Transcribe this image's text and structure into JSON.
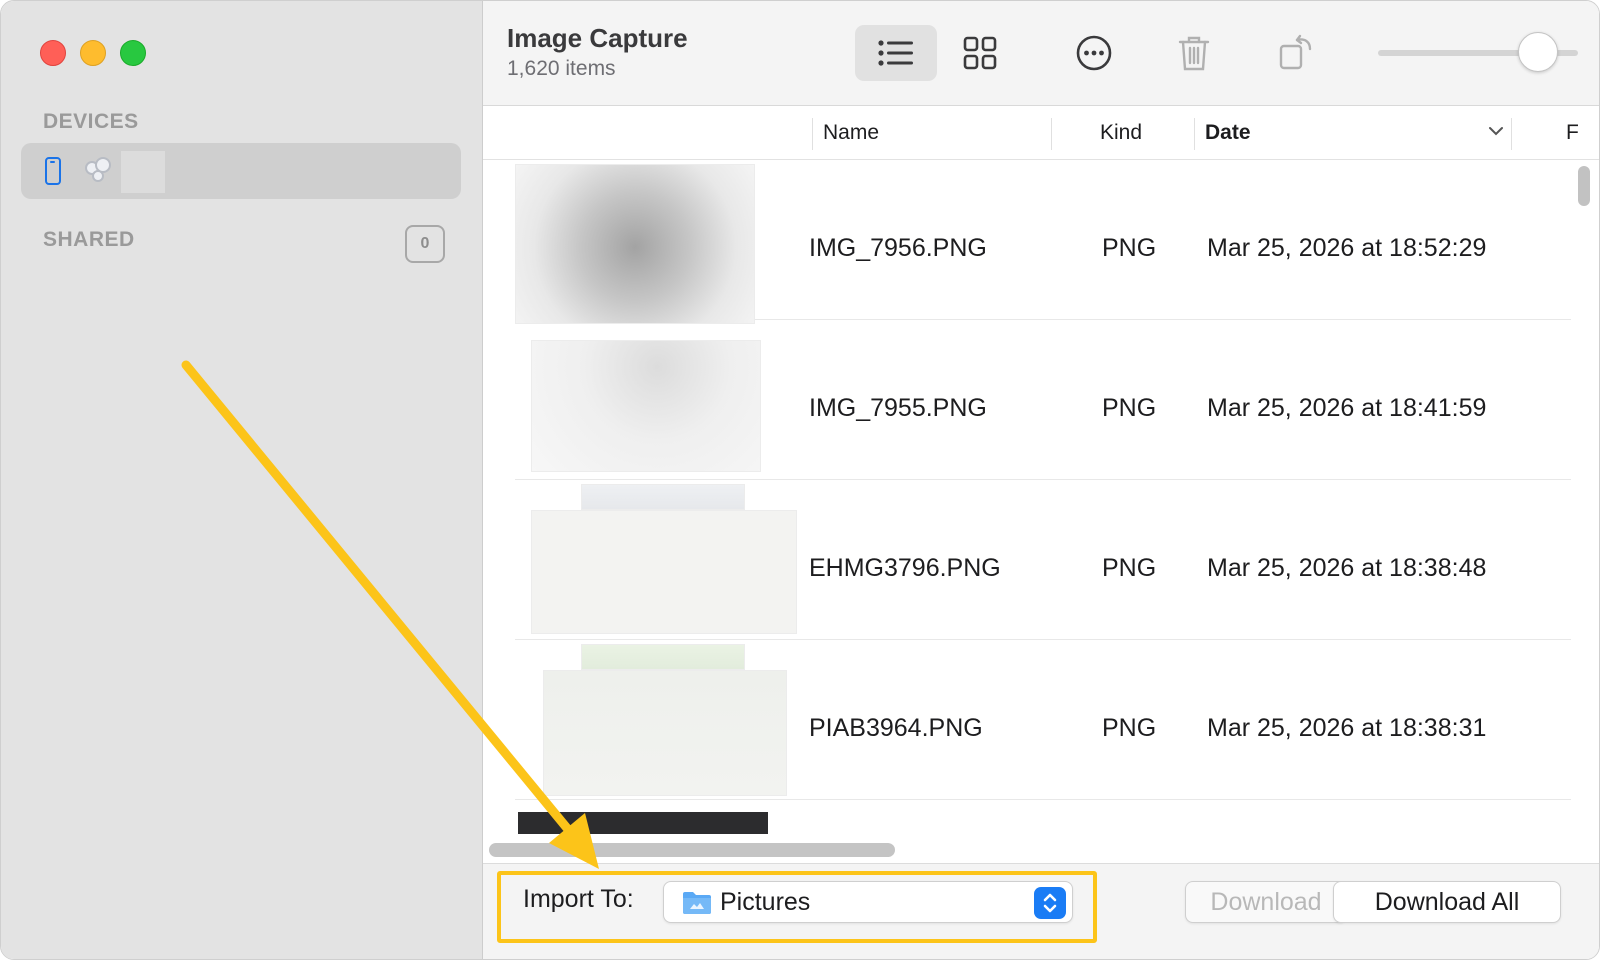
{
  "window": {
    "title": "Image Capture",
    "subtitle": "1,620 items"
  },
  "sidebar": {
    "devices_label": "DEVICES",
    "shared_label": "SHARED",
    "shared_count": "0"
  },
  "toolbar": {
    "list_view_icon": "list-icon",
    "grid_view_icon": "grid-icon",
    "more_icon": "ellipsis-circle-icon",
    "delete_icon": "trash-icon",
    "rotate_icon": "rotate-left-icon",
    "thumbnail_size": 0.8
  },
  "columns": {
    "name": "Name",
    "kind": "Kind",
    "date": "Date",
    "next_partial": "F"
  },
  "files": [
    {
      "name": "IMG_7956.PNG",
      "kind": "PNG",
      "date": "Mar 25, 2026 at 18:52:29"
    },
    {
      "name": "IMG_7955.PNG",
      "kind": "PNG",
      "date": "Mar 25, 2026 at 18:41:59"
    },
    {
      "name": "EHMG3796.PNG",
      "kind": "PNG",
      "date": "Mar 25, 2026 at 18:38:48"
    },
    {
      "name": "PIAB3964.PNG",
      "kind": "PNG",
      "date": "Mar 25, 2026 at 18:38:31"
    }
  ],
  "bottom": {
    "import_label": "Import To:",
    "import_destination": "Pictures",
    "download_label": "Download",
    "download_all_label": "Download All"
  },
  "colors": {
    "accent": "#1a7cf5",
    "annotation": "#fcc419"
  }
}
